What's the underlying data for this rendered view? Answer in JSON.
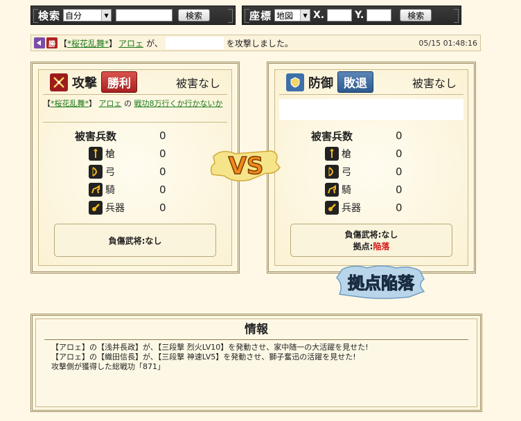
{
  "search": {
    "title": "検索",
    "scope": "自分",
    "button": "検索"
  },
  "coords": {
    "title": "座標",
    "map": "地図",
    "x_label": "X.",
    "y_label": "Y.",
    "button": "検索"
  },
  "report": {
    "badge_win": "勝",
    "bracket_open": "【",
    "alliance": "*桜花乱舞*",
    "bracket_close": "】",
    "player": "アロェ",
    "ga": "が、",
    "message": "を攻撃しました。",
    "time": "05/15 01:48:16"
  },
  "attack": {
    "title": "攻撃",
    "result": "勝利",
    "damage": "被害なし",
    "bracket_open": "【",
    "alliance": "*桜花乱舞*",
    "bracket_close": "】",
    "player": "アロェ",
    "no": "の",
    "unit_name": "戦功8万行くか行かないか",
    "stats_head": "被害兵数",
    "stats_head_val": "0",
    "rows": [
      {
        "label": "槍",
        "value": "0"
      },
      {
        "label": "弓",
        "value": "0"
      },
      {
        "label": "騎",
        "value": "0"
      },
      {
        "label": "兵器",
        "value": "0"
      }
    ],
    "injury": "負傷武将:なし"
  },
  "defense": {
    "title": "防御",
    "result": "敗退",
    "damage": "被害なし",
    "stats_head": "被害兵数",
    "stats_head_val": "0",
    "rows": [
      {
        "label": "槍",
        "value": "0"
      },
      {
        "label": "弓",
        "value": "0"
      },
      {
        "label": "騎",
        "value": "0"
      },
      {
        "label": "兵器",
        "value": "0"
      }
    ],
    "injury": "負傷武将:なし",
    "base_label": "拠点:",
    "base_status": "陥落"
  },
  "vs_text": "VS",
  "banner_text": "拠点陥落",
  "info": {
    "title": "情報",
    "lines": [
      "【アロェ】の【浅井長政】が、【三段撃 烈火LV10】を発動させ、家中随一の大活躍を見せた!",
      "【アロェ】の【織田信長】が、【三段撃 神速LV5】を発動させ、獅子奮迅の活躍を見せた!",
      "攻撃側が獲得した総戦功「871」"
    ]
  },
  "colors": {
    "red": "#b22222",
    "blue": "#2d5a8e",
    "gold": "#f2b81c",
    "fallen": "#d21a1a"
  }
}
